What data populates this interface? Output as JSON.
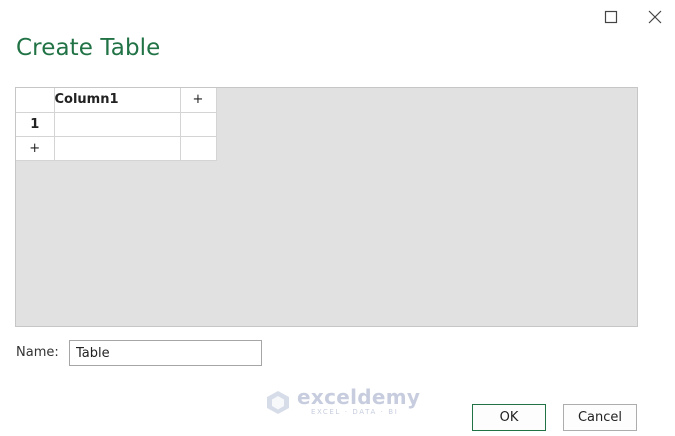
{
  "dialog": {
    "title": "Create Table"
  },
  "grid": {
    "column_header": "Column1",
    "add_column": "+",
    "row_number": "1",
    "add_row": "+",
    "cell_value": ""
  },
  "name_field": {
    "label": "Name:",
    "value": "Table"
  },
  "watermark": {
    "brand": "exceldemy",
    "tagline": "EXCEL · DATA · BI"
  },
  "buttons": {
    "ok": "OK",
    "cancel": "Cancel"
  },
  "colors": {
    "accent": "#217346",
    "selected_cell": "#d5eedf",
    "grid_background": "#e1e1e1"
  },
  "icons": {
    "maximize": "maximize-icon",
    "close": "close-icon"
  }
}
